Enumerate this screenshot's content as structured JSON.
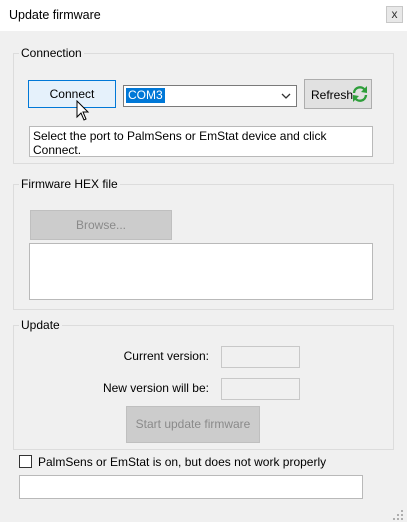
{
  "window": {
    "title": "Update firmware",
    "close_label": "x"
  },
  "connection": {
    "legend": "Connection",
    "connect_label": "Connect",
    "port_value": "COM3",
    "refresh_label": "Refresh",
    "status_text": "Select the port to PalmSens or EmStat device and click Connect."
  },
  "firmware": {
    "legend": "Firmware HEX file",
    "browse_label": "Browse...",
    "file_text": ""
  },
  "update": {
    "legend": "Update",
    "current_version_label": "Current version:",
    "current_version_value": "",
    "new_version_label": "New version will be:",
    "new_version_value": "",
    "start_label": "Start update firmware"
  },
  "footer": {
    "checkbox_label": "PalmSens or EmStat is on, but does not work properly",
    "checkbox_checked": false,
    "message_text": ""
  },
  "icons": {
    "refresh": "refresh-icon",
    "dropdown": "chevron-down-icon",
    "cursor": "mouse-cursor-icon"
  },
  "colors": {
    "focus_border": "#0078d7",
    "selection": "#0078d7",
    "refresh_green": "#2e9e3a"
  }
}
